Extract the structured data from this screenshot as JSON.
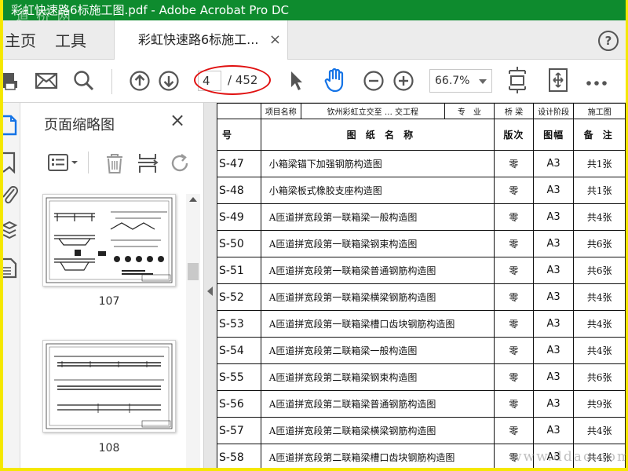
{
  "window": {
    "title": "彩虹快速路6标施工图.pdf - Adobe Acrobat Pro DC",
    "watermark_top": "道 桥 网",
    "watermark_bottom": "www.ddao.com",
    "frame_color": "#f5e800",
    "titlebar_color": "#0e8b2e"
  },
  "tabs": {
    "home": "主页",
    "tools": "工具",
    "document": "彩虹快速路6标施工...",
    "close": "×",
    "help": "?"
  },
  "toolbar": {
    "icons": [
      "print-icon",
      "email-icon",
      "search-icon",
      "prev-page-icon",
      "next-page-icon",
      "select-cursor-icon",
      "hand-tool-icon",
      "zoom-out-icon",
      "zoom-in-icon",
      "fit-page-icon",
      "full-screen-icon",
      "more-icon"
    ],
    "current_page": "4",
    "total_pages": "/ 452",
    "zoom": "66.7%",
    "highlight_color": "#e01010",
    "accent_color": "#1473e6"
  },
  "thumbnails_panel": {
    "title": "页面缩略图",
    "close": "×",
    "icons": [
      "options-icon",
      "delete-icon",
      "insert-page-icon",
      "rotate-icon"
    ],
    "pages": [
      {
        "label": "107"
      },
      {
        "label": "108"
      }
    ]
  },
  "left_rail": {
    "icons": [
      "page-thumbnails-icon",
      "bookmarks-icon",
      "attachments-icon",
      "layers-icon",
      "content-icon"
    ]
  },
  "document": {
    "top_strip": [
      "项目名称",
      "钦州彩虹立交至 … 交工程",
      "专　业",
      "桥 梁",
      "设计阶段",
      "施工图"
    ],
    "headers": {
      "no": "号",
      "name": "图 纸 名 称",
      "version": "版次",
      "size": "图幅",
      "note": "备 注"
    },
    "rows": [
      {
        "no": "S-47",
        "name": "小箱梁锚下加强钢筋构造图",
        "version": "零",
        "size": "A3",
        "note": "共1张"
      },
      {
        "no": "S-48",
        "name": "小箱梁板式橡胶支座构造图",
        "version": "零",
        "size": "A3",
        "note": "共1张"
      },
      {
        "no": "S-49",
        "name": "A匝道拼宽段第一联箱梁一般构造图",
        "version": "零",
        "size": "A3",
        "note": "共4张"
      },
      {
        "no": "S-50",
        "name": "A匝道拼宽段第一联箱梁钢束构造图",
        "version": "零",
        "size": "A3",
        "note": "共6张"
      },
      {
        "no": "S-51",
        "name": "A匝道拼宽段第一联箱梁普通钢筋构造图",
        "version": "零",
        "size": "A3",
        "note": "共6张"
      },
      {
        "no": "S-52",
        "name": "A匝道拼宽段第一联箱梁横梁钢筋构造图",
        "version": "零",
        "size": "A3",
        "note": "共4张"
      },
      {
        "no": "S-53",
        "name": "A匝道拼宽段第一联箱梁槽口齿块钢筋构造图",
        "version": "零",
        "size": "A3",
        "note": "共4张"
      },
      {
        "no": "S-54",
        "name": "A匝道拼宽段第二联箱梁一般构造图",
        "version": "零",
        "size": "A3",
        "note": "共4张"
      },
      {
        "no": "S-55",
        "name": "A匝道拼宽段第二联箱梁钢束构造图",
        "version": "零",
        "size": "A3",
        "note": "共6张"
      },
      {
        "no": "S-56",
        "name": "A匝道拼宽段第二联箱梁普通钢筋构造图",
        "version": "零",
        "size": "A3",
        "note": "共9张"
      },
      {
        "no": "S-57",
        "name": "A匝道拼宽段第二联箱梁横梁钢筋构造图",
        "version": "零",
        "size": "A3",
        "note": "共4张"
      },
      {
        "no": "S-58",
        "name": "A匝道拼宽段第二联箱梁槽口齿块钢筋构造图",
        "version": "零",
        "size": "A3",
        "note": "共4张"
      }
    ]
  }
}
